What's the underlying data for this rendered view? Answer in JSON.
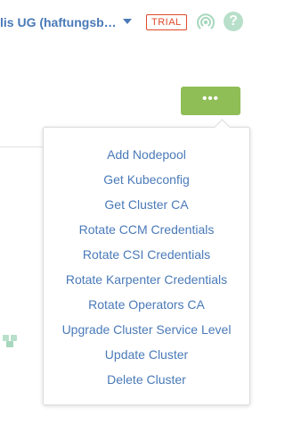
{
  "header": {
    "org_name": "lis UG (haftungsb…",
    "trial_badge": "TRIAL",
    "help_glyph": "?",
    "icons": {
      "caret": "chevron-down-icon",
      "signal": "signal-icon",
      "help": "help-icon"
    }
  },
  "actions_button": {
    "label": "•••"
  },
  "menu": {
    "items": [
      {
        "label": "Add Nodepool"
      },
      {
        "label": "Get Kubeconfig"
      },
      {
        "label": "Get Cluster CA"
      },
      {
        "label": "Rotate CCM Credentials"
      },
      {
        "label": "Rotate CSI Credentials"
      },
      {
        "label": "Rotate Karpenter Credentials"
      },
      {
        "label": "Rotate Operators CA"
      },
      {
        "label": "Upgrade Cluster Service Level"
      },
      {
        "label": "Update Cluster"
      },
      {
        "label": "Delete Cluster"
      }
    ]
  },
  "colors": {
    "link": "#4a7ab8",
    "trial": "#e0492a",
    "action_green": "#8fbd56",
    "help_green": "#b7dfc9",
    "icon_green": "#a7d7bd"
  }
}
